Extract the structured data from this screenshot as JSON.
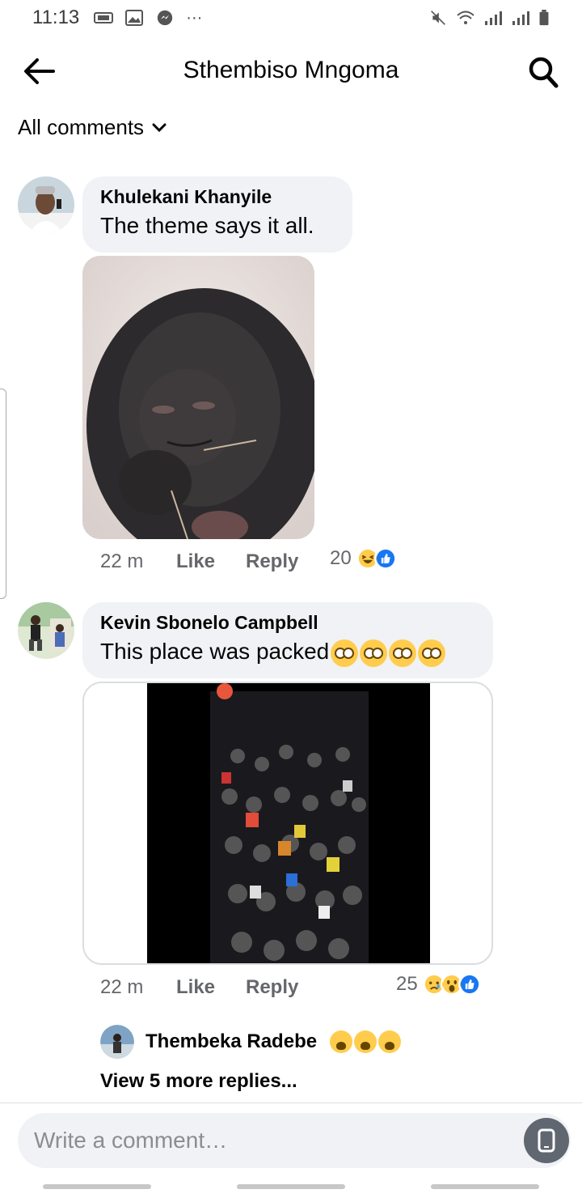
{
  "status_bar": {
    "time": "11:13",
    "dots": "···"
  },
  "header": {
    "title": "Sthembiso Mngoma"
  },
  "filter": {
    "label": "All comments"
  },
  "comments": [
    {
      "author": "Khulekani Khanyile",
      "text": "The theme says it all.",
      "time": "22 m",
      "like": "Like",
      "reply": "Reply",
      "reaction_count": "20"
    },
    {
      "author": "Kevin Sbonelo Campbell",
      "text": "This place was packed",
      "time": "22 m",
      "like": "Like",
      "reply": "Reply",
      "reaction_count": "25",
      "reply_preview": {
        "author": "Thembeka Radebe"
      },
      "view_more": "View 5 more replies..."
    }
  ],
  "composer": {
    "placeholder": "Write a comment…"
  },
  "colors": {
    "like_blue": "#1877f2",
    "bubble_gray": "#f0f2f5",
    "meta_gray": "#65676b",
    "haha_yellow": "#ffcc4d"
  }
}
